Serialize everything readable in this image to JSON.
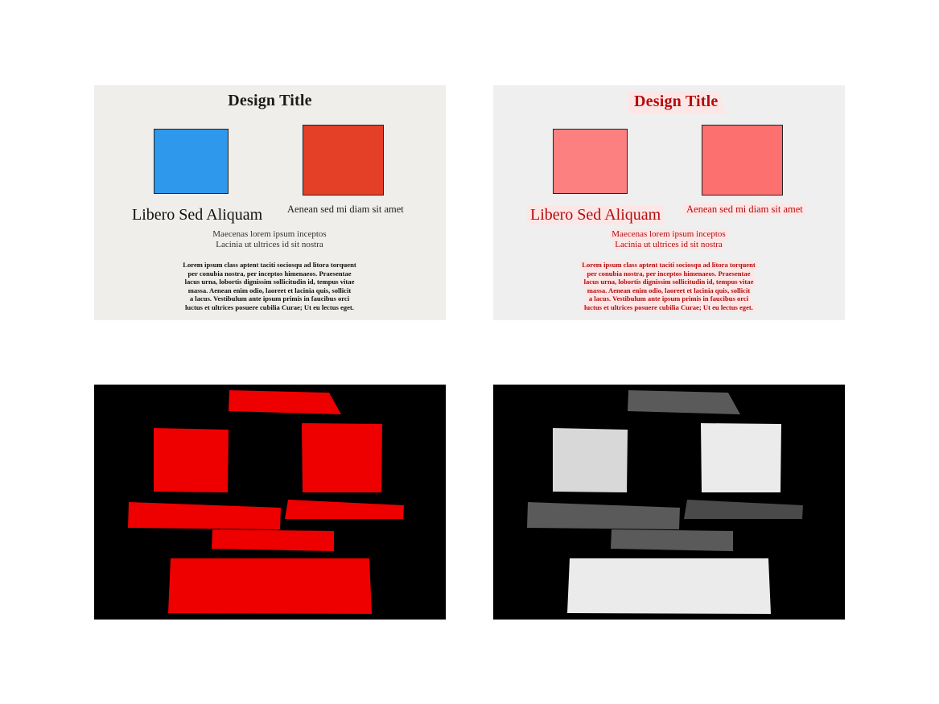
{
  "design": {
    "title": "Design Title",
    "heading": "Libero Sed Aliquam",
    "subheading": "Aenean sed mi diam sit amet",
    "caption_lines": [
      "Maecenas lorem ipsum inceptos",
      "Lacinia ut ultrices id sit nostra"
    ],
    "body_lines": [
      "Lorem ipsum class aptent taciti sociosqu ad litora torquent",
      "per conubia nostra, per inceptos himenaeos. Praesentae",
      "lacus urna, lobortis dignissim sollicitudin id, tempus vitae",
      "massa. Aenean enim odio, laoreet et lacinia quis, sollicit",
      "a lacus. Vestibulum ante ipsum primis in faucibus orci",
      "luctus et ultrices posuere cubilia Curae; Ut eu lectus eget."
    ]
  },
  "colors": {
    "panel_bg": "#efeeeb",
    "highlight_bg": "#efefef",
    "blue_square": "#2e98ec",
    "red_square": "#e44027",
    "highlight_text": "#b30d0d",
    "highlight_square_a": "#fc8080",
    "highlight_square_b": "#fc7070",
    "mask_bg": "#000000",
    "mask_red": "#ee0000",
    "gray_dark": "#5a5a5a",
    "gray_mid": "#4a4a4a",
    "gray_light": "#d8d8d8",
    "gray_lighter": "#ebebeb"
  }
}
